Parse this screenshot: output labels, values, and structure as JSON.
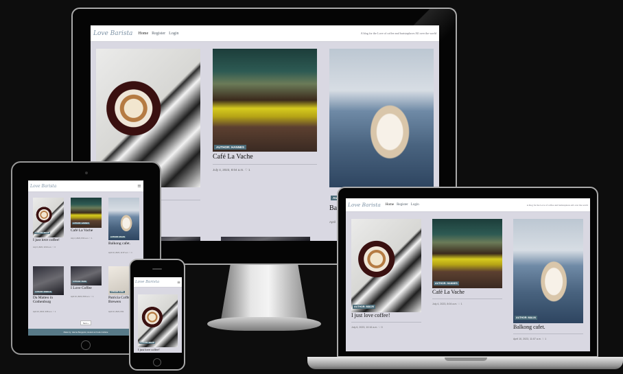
{
  "site": {
    "logo": "Love Barista",
    "nav": [
      "Home",
      "Register",
      "Login"
    ],
    "tagline": "A blog for the Love of coffee and baristaplaces All over the world"
  },
  "desktop_posts": [
    {
      "title": "",
      "author": "",
      "meta": ""
    },
    {
      "title": "Café La Vache",
      "author": "AUTHOR: HANNES",
      "meta": "July 4, 2023, 8:04 a.m. ♡ 1"
    },
    {
      "title": "Ba",
      "author": "AUTH",
      "meta": "April"
    }
  ],
  "laptop_posts": [
    {
      "title": "I just love coffee!",
      "author": "AUTHOR: MALIN",
      "meta": "July 6, 2023, 10:16 a.m. ♡ 0"
    },
    {
      "title": "Café La Vache",
      "author": "AUTHOR: HANNES",
      "meta": "July 4, 2023, 8:04 a.m. ♡ 1"
    },
    {
      "title": "Balkong cafet.",
      "author": "AUTHOR: MALIN",
      "meta": "April 10, 2023, 11:07 a.m. ♡ 1"
    }
  ],
  "tablet_posts": [
    {
      "title": "I just love coffee!",
      "author": "AUTHOR: MALIN",
      "meta": "July 6, 2023, 10:16 a.m. ♡ 0"
    },
    {
      "title": "Café La Vache",
      "author": "AUTHOR: HANNES",
      "meta": "July 4, 2023, 8:04 a.m. ♡ 1"
    },
    {
      "title": "Balkong cafet.",
      "author": "AUTHOR: MALIN",
      "meta": "April 10, 2023, 11:07 a.m. ♡ 1"
    },
    {
      "title": "Da Matteo in Gothenburg",
      "author": "AUTHOR: EMMA IS",
      "meta": "April 10, 2023, 9:08 a.m. ♡ 1"
    },
    {
      "title": "I Love Coffee",
      "author": "AUTHOR: PERK",
      "meta": "April 10, 2023, 8:09 a.m. ♡ 1"
    },
    {
      "title": "Patricia Coffee Brewers",
      "author": "AUTHOR: KARL",
      "meta": "April 10, 2023, 8:01"
    }
  ],
  "tablet_footer": "Made by: Hanna Bergqvist, student at Code Institute",
  "pagination_label": "Next »",
  "phone_posts": [
    {
      "title": "I just love coffee!",
      "author": "AUTHOR: MALIN"
    }
  ],
  "hamburger": "≡"
}
